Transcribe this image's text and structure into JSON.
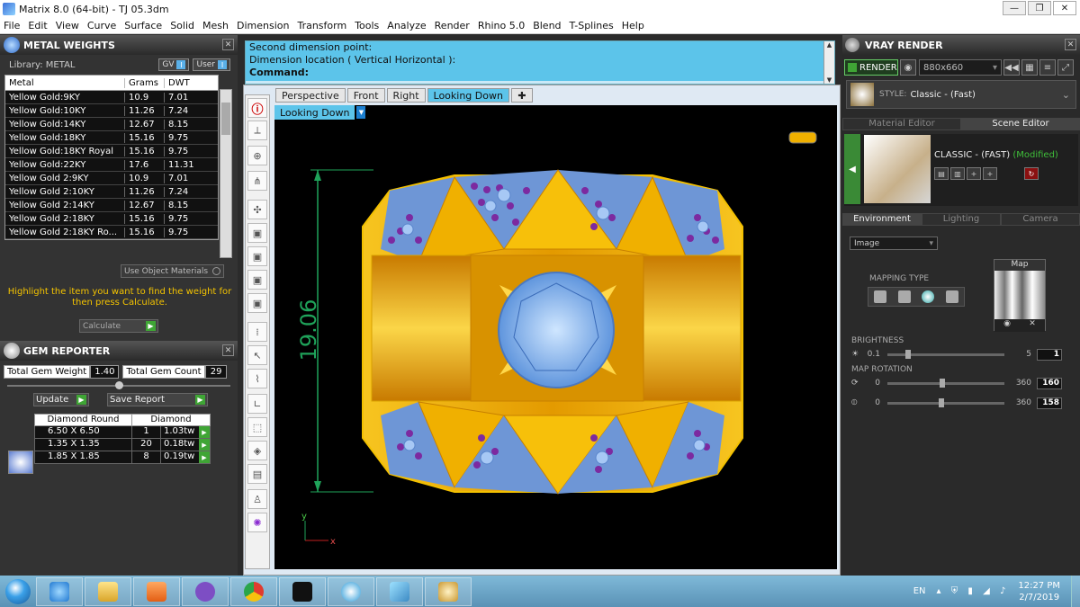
{
  "window": {
    "title": "Matrix 8.0 (64-bit) - TJ 05.3dm",
    "min": "—",
    "max": "❐",
    "close": "✕"
  },
  "menu": [
    "File",
    "Edit",
    "View",
    "Curve",
    "Surface",
    "Solid",
    "Mesh",
    "Dimension",
    "Transform",
    "Tools",
    "Analyze",
    "Render",
    "Rhino 5.0",
    "Blend",
    "T-Splines",
    "Help"
  ],
  "metal_weights": {
    "title": "METAL WEIGHTS",
    "library_label": "Library: METAL",
    "gv": "GV",
    "user": "User",
    "columns": [
      "Metal",
      "Grams",
      "DWT"
    ],
    "rows": [
      [
        "Yellow Gold:9KY",
        "10.9",
        "7.01"
      ],
      [
        "Yellow Gold:10KY",
        "11.26",
        "7.24"
      ],
      [
        "Yellow Gold:14KY",
        "12.67",
        "8.15"
      ],
      [
        "Yellow Gold:18KY",
        "15.16",
        "9.75"
      ],
      [
        "Yellow Gold:18KY Royal",
        "15.16",
        "9.75"
      ],
      [
        "Yellow Gold:22KY",
        "17.6",
        "11.31"
      ],
      [
        "Yellow Gold 2:9KY",
        "10.9",
        "7.01"
      ],
      [
        "Yellow Gold 2:10KY",
        "11.26",
        "7.24"
      ],
      [
        "Yellow Gold 2:14KY",
        "12.67",
        "8.15"
      ],
      [
        "Yellow Gold 2:18KY",
        "15.16",
        "9.75"
      ],
      [
        "Yellow Gold 2:18KY Ro...",
        "15.16",
        "9.75"
      ]
    ],
    "use_object_materials": "Use Object Materials",
    "highlight_text": "Highlight the item you want to find the weight for then press Calculate.",
    "calculate": "Calculate"
  },
  "gem_reporter": {
    "title": "GEM REPORTER",
    "total_weight_label": "Total Gem Weight",
    "total_weight": "1.40",
    "total_count_label": "Total Gem Count",
    "total_count": "29",
    "update": "Update",
    "save_report": "Save Report",
    "head_shape": "Diamond Round",
    "head_type": "Diamond",
    "rows": [
      [
        "6.50 X 6.50",
        "1",
        "1.03tw"
      ],
      [
        "1.35 X 1.35",
        "20",
        "0.18tw"
      ],
      [
        "1.85 X 1.85",
        "8",
        "0.19tw"
      ]
    ]
  },
  "command": {
    "line1": "Second dimension point:",
    "line2": "Dimension location ( Vertical  Horizontal ):",
    "prompt": "Command:"
  },
  "viewport": {
    "tabs": [
      "Perspective",
      "Front",
      "Right",
      "Looking Down"
    ],
    "active_tab": "Looking Down",
    "label": "Looking Down",
    "dimension": "19.06",
    "axis_y": "y",
    "axis_x": "x",
    "colors": {
      "gold": "#f0b000",
      "stone": "#7fb2ee",
      "amethyst": "#6a1a8a",
      "dim": "#1fa35a"
    }
  },
  "vray": {
    "title": "VRAY RENDER",
    "render": "RENDER",
    "resolution": "880x660",
    "style_label": "STYLE:",
    "style_value": "Classic - (Fast)",
    "tabs": [
      "Material Editor",
      "Scene Editor"
    ],
    "scene_name": "CLASSIC - (FAST)",
    "modified": "(Modified)",
    "env_tabs": [
      "Environment",
      "Lighting",
      "Camera"
    ],
    "image_select": "Image",
    "mapping_type": "MAPPING TYPE",
    "map_label": "Map",
    "brightness_label": "BRIGHTNESS",
    "brightness_min": "0.1",
    "brightness_max": "5",
    "brightness_value": "1",
    "rotation_label": "MAP ROTATION",
    "rot1_min": "0",
    "rot1_max": "360",
    "rot1_value": "160",
    "rot2_min": "0",
    "rot2_max": "360",
    "rot2_value": "158"
  },
  "taskbar": {
    "lang": "EN",
    "time": "12:27 PM",
    "date": "2/7/2019"
  }
}
